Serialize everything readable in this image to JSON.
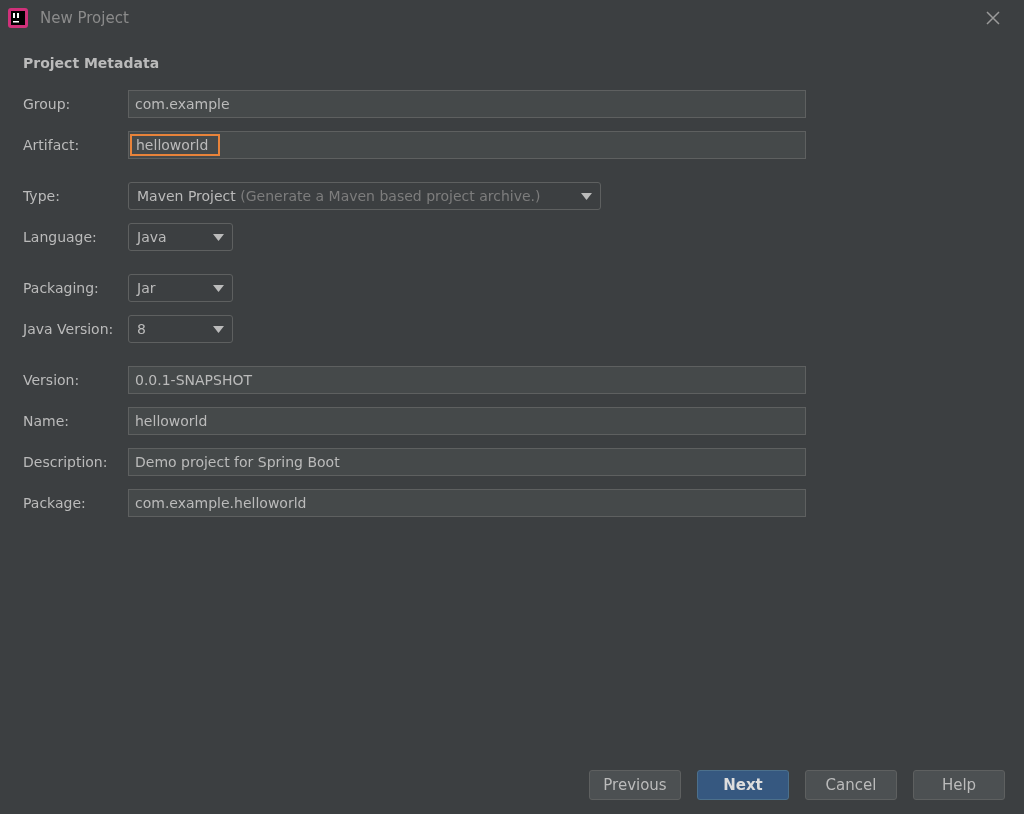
{
  "window": {
    "title": "New Project"
  },
  "heading": "Project Metadata",
  "field_groups": [
    [
      {
        "label": "Group:",
        "kind": "text",
        "value": "com.example",
        "highlighted": false
      },
      {
        "label": "Artifact:",
        "kind": "text",
        "value": "helloworld",
        "highlighted": true
      }
    ],
    [
      {
        "label": "Type:",
        "kind": "dropdown",
        "value": "Maven Project",
        "hint": "(Generate a Maven based project archive.)"
      },
      {
        "label": "Language:",
        "kind": "dropdown",
        "value": "Java"
      }
    ],
    [
      {
        "label": "Packaging:",
        "kind": "dropdown",
        "value": "Jar"
      },
      {
        "label": "Java Version:",
        "kind": "dropdown",
        "value": "8"
      }
    ],
    [
      {
        "label": "Version:",
        "kind": "text",
        "value": "0.0.1-SNAPSHOT",
        "highlighted": false
      },
      {
        "label": "Name:",
        "kind": "text",
        "value": "helloworld",
        "highlighted": false
      },
      {
        "label": "Description:",
        "kind": "text",
        "value": "Demo project for Spring Boot",
        "highlighted": false
      },
      {
        "label": "Package:",
        "kind": "text",
        "value": "com.example.helloworld",
        "highlighted": false
      }
    ]
  ],
  "buttons": [
    {
      "label": "Previous",
      "default": false
    },
    {
      "label": "Next",
      "default": true
    },
    {
      "label": "Cancel",
      "default": false
    },
    {
      "label": "Help",
      "default": false
    }
  ]
}
